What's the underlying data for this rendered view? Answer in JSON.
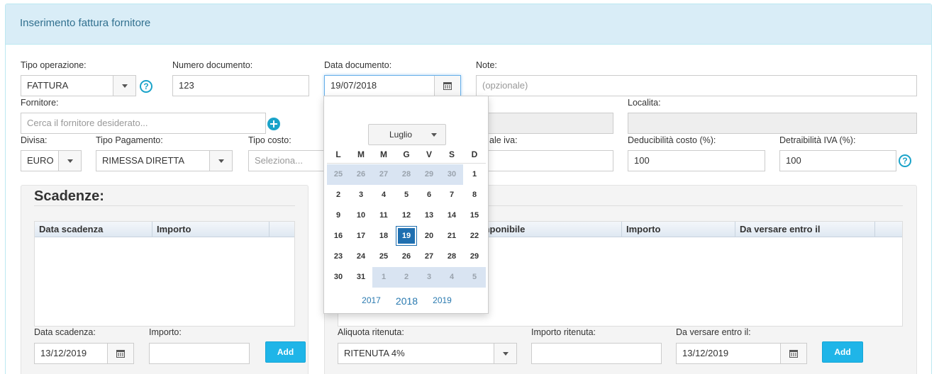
{
  "panel": {
    "title": "Inserimento fattura fornitore"
  },
  "form": {
    "tipo_operazione": {
      "label": "Tipo operazione:",
      "value": "FATTURA"
    },
    "numero_documento": {
      "label": "Numero documento:",
      "value": "123"
    },
    "data_documento": {
      "label": "Data documento:",
      "value": "19/07/2018"
    },
    "note": {
      "label": "Note:",
      "placeholder": "(opzionale)"
    },
    "fornitore": {
      "label": "Fornitore:",
      "placeholder": "Cerca il fornitore desiderato..."
    },
    "localita": {
      "label": "Localita:",
      "value": ""
    },
    "divisa": {
      "label": "Divisa:",
      "value": "EURO"
    },
    "tipo_pagamento": {
      "label": "Tipo Pagamento:",
      "value": "RIMESSA DIRETTA"
    },
    "tipo_costo": {
      "label": "Tipo costo:",
      "placeholder": "Seleziona..."
    },
    "totale_iva": {
      "label": "ale iva:",
      "value": ""
    },
    "deducibilita": {
      "label": "Deducibilità costo (%):",
      "value": "100"
    },
    "detraibilita": {
      "label": "Detraibilità IVA (%):",
      "value": "100"
    },
    "help_glyph": "?"
  },
  "scadenze": {
    "title": "Scadenze:",
    "columns": [
      "Data scadenza",
      "Importo"
    ],
    "data_scadenza_label": "Data scadenza:",
    "data_scadenza_value": "13/12/2019",
    "importo_label": "Importo:",
    "add_label": "Add"
  },
  "ritenute": {
    "columns": [
      "mponibile",
      "Importo",
      "Da versare entro il"
    ],
    "aliquota_label": "Aliquota ritenuta:",
    "aliquota_value": "RITENUTA 4%",
    "importo_label": "Importo ritenuta:",
    "da_versare_label": "Da versare entro il:",
    "da_versare_value": "13/12/2019",
    "add_label": "Add"
  },
  "datepicker": {
    "month": "Luglio",
    "weekdays": [
      "L",
      "M",
      "M",
      "G",
      "V",
      "S",
      "D"
    ],
    "weeks": [
      [
        "25",
        "26",
        "27",
        "28",
        "29",
        "30",
        "1"
      ],
      [
        "2",
        "3",
        "4",
        "5",
        "6",
        "7",
        "8"
      ],
      [
        "9",
        "10",
        "11",
        "12",
        "13",
        "14",
        "15"
      ],
      [
        "16",
        "17",
        "18",
        "19",
        "20",
        "21",
        "22"
      ],
      [
        "23",
        "24",
        "25",
        "26",
        "27",
        "28",
        "29"
      ],
      [
        "30",
        "31",
        "1",
        "2",
        "3",
        "4",
        "5"
      ]
    ],
    "selected_day": "19",
    "years": [
      "2017",
      "2018",
      "2019"
    ],
    "current_year": "2018"
  }
}
